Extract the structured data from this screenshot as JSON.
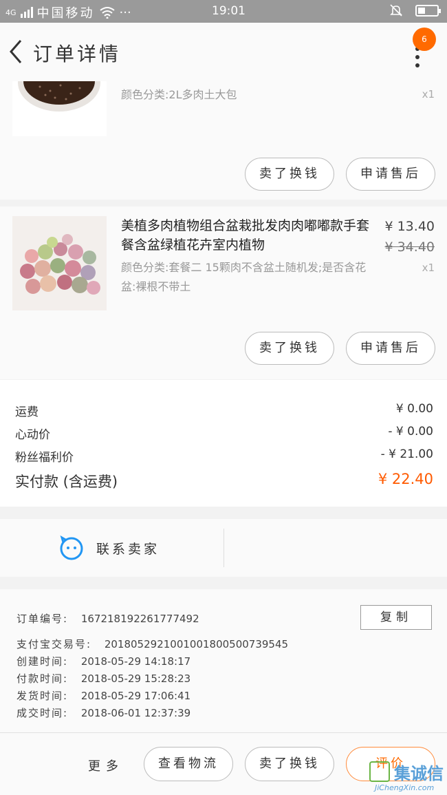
{
  "status_bar": {
    "carrier": "中国移动",
    "signal_label": "4G",
    "dots": "···",
    "time": "19:01"
  },
  "header": {
    "title": "订单详情",
    "badge_count": "6"
  },
  "products": [
    {
      "title": "",
      "spec": "颜色分类:2L多肉土大包",
      "qty": "x1",
      "buttons": [
        "卖了换钱",
        "申请售后"
      ]
    },
    {
      "title": "美植多肉植物组合盆栽批发肉肉嘟嘟款手套餐含盆绿植花卉室内植物",
      "spec": "颜色分类:套餐二 15颗肉不含盆土随机发;是否含花盆:裸根不带土",
      "price": "¥ 13.40",
      "orig_price": "¥ 34.40",
      "qty": "x1",
      "buttons": [
        "卖了换钱",
        "申请售后"
      ]
    }
  ],
  "fees": [
    {
      "label": "运费",
      "value": "¥ 0.00"
    },
    {
      "label": "心动价",
      "value": "- ¥ 0.00"
    },
    {
      "label": "粉丝福利价",
      "value": "- ¥ 21.00"
    }
  ],
  "total": {
    "label": "实付款 (含运费)",
    "value": "¥ 22.40"
  },
  "contact": {
    "label": "联系卖家"
  },
  "order_info": {
    "copy_label": "复制",
    "lines": [
      {
        "label": "订单编号:",
        "value": "167218192261777492"
      },
      {
        "label": "支付宝交易号:",
        "value": "2018052921001001800500739545"
      },
      {
        "label": "创建时间:",
        "value": "2018-05-29 14:18:17"
      },
      {
        "label": "付款时间:",
        "value": "2018-05-29 15:28:23"
      },
      {
        "label": "发货时间:",
        "value": "2018-05-29 17:06:41"
      },
      {
        "label": "成交时间:",
        "value": "2018-06-01 12:37:39"
      }
    ]
  },
  "bottom_bar": {
    "more": "更多",
    "view_logistics": "查看物流",
    "sell": "卖了换钱",
    "review": "评价"
  },
  "watermark": {
    "big": "集诚信",
    "small": "JiChengXin.com"
  },
  "colors": {
    "accent": "#ff6a00",
    "status_bar": "#9a9a9a",
    "contact_icon": "#2196f3"
  }
}
